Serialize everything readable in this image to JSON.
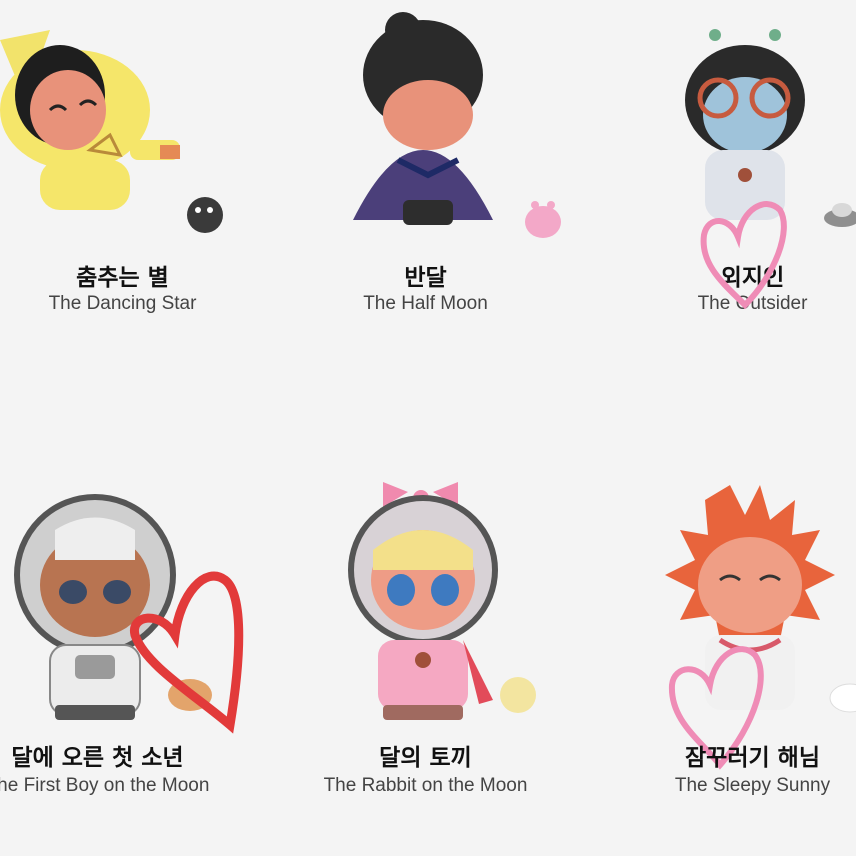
{
  "figures": [
    {
      "ko": "춤추는 별",
      "en": "The Dancing Star",
      "icon": "dancing-star-figure"
    },
    {
      "ko": "반달",
      "en": "The Half Moon",
      "icon": "half-moon-figure"
    },
    {
      "ko": "외지인",
      "en": "The Outsider",
      "icon": "outsider-figure"
    },
    {
      "ko": "달에 오른 첫 소년",
      "en": "The First Boy on the Moon",
      "icon": "astronaut-boy-figure"
    },
    {
      "ko": "달의 토끼",
      "en": "The Rabbit on the Moon",
      "icon": "rabbit-astronaut-figure"
    },
    {
      "ko": "잠꾸러기 해님",
      "en": "The Sleepy Sunny",
      "icon": "sleepy-sun-figure"
    }
  ],
  "colors": {
    "red_heart": "#e23a3a",
    "pink_heart": "#ef8cb6",
    "background": "#f4f4f4"
  }
}
